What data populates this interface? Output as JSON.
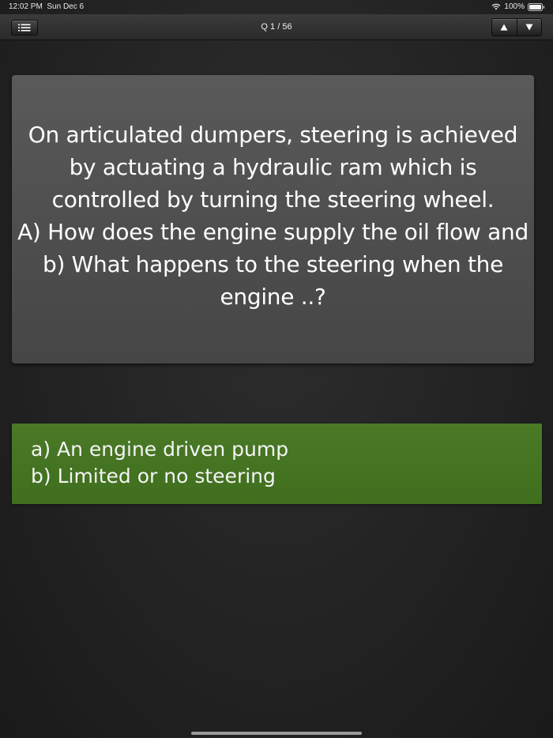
{
  "status_bar": {
    "time": "12:02 PM",
    "date": "Sun Dec 6",
    "battery": "100%",
    "icons": [
      "wifi-icon",
      "battery-icon"
    ]
  },
  "toolbar": {
    "menu_icon": "list-icon",
    "counter": "Q 1 / 56",
    "prev_icon": "triangle-up-icon",
    "next_icon": "triangle-down-icon"
  },
  "question": {
    "text": "On articulated dumpers, steering is achieved by actuating a hydraulic ram which is controlled by turning the steering wheel.\nA) How does the engine supply the oil flow and\nb) What happens to the steering when the engine ..?"
  },
  "answer": {
    "lines": [
      "a) An engine driven pump",
      "b) Limited or no steering"
    ]
  },
  "colors": {
    "answer_background": "#45741f",
    "question_background": "#525252",
    "page_background": "#262626"
  }
}
